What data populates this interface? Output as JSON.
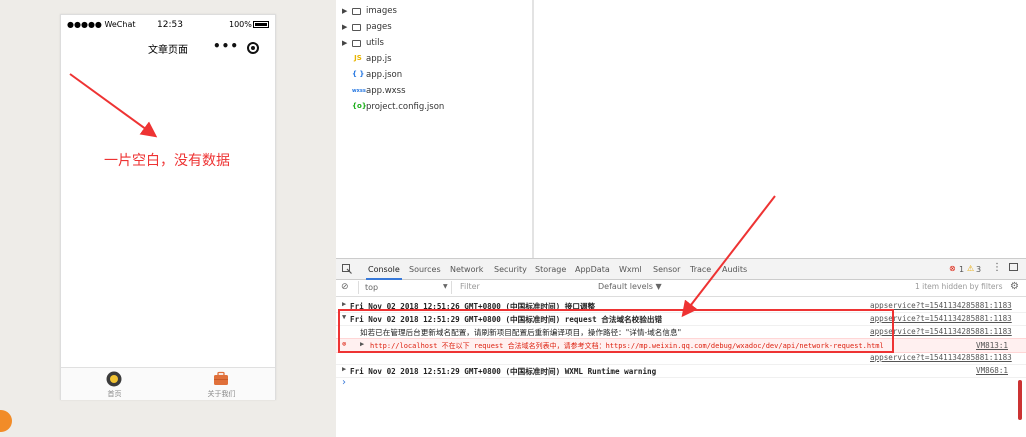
{
  "simulator": {
    "status": {
      "carrier": "●●●●● WeChat",
      "time": "12:53",
      "battery": "100%"
    },
    "nav_title": "文章页面",
    "more_icon": "more-dots-icon",
    "capsule_icon": "target-icon",
    "annotation": "一片空白，没有数据",
    "tabbar": [
      {
        "label": "首页",
        "icon": "home-icon",
        "color": "#3b3b3b"
      },
      {
        "label": "关于我们",
        "icon": "briefcase-icon",
        "color": "#e0703a"
      }
    ]
  },
  "files": [
    {
      "name": "images",
      "type": "folder"
    },
    {
      "name": "pages",
      "type": "folder"
    },
    {
      "name": "utils",
      "type": "folder"
    },
    {
      "name": "app.js",
      "type": "js",
      "icon": "JS",
      "color": "#e8b400"
    },
    {
      "name": "app.json",
      "type": "json",
      "icon": "{ }",
      "color": "#2a7ae2"
    },
    {
      "name": "app.wxss",
      "type": "wxss",
      "icon": "wxss",
      "color": "#2a7ae2"
    },
    {
      "name": "project.config.json",
      "type": "config",
      "icon": "{o}",
      "color": "#1aad19"
    }
  ],
  "devtools": {
    "tabs": [
      "Console",
      "Sources",
      "Network",
      "Security",
      "Storage",
      "AppData",
      "Wxml",
      "Sensor",
      "Trace",
      "Audits"
    ],
    "active_tab": "Console",
    "error_count": "1",
    "warning_count": "3",
    "context": "top",
    "filter_placeholder": "Filter",
    "levels": "Default levels ▼",
    "hidden_note": "1 item hidden by filters",
    "logs": [
      {
        "msg": "Fri Nov 02 2018 12:51:26 GMT+0800 (中国标准时间) 接口调整",
        "src": "appservice?t=1541134285881:1183",
        "kind": "group"
      },
      {
        "msg": "Fri Nov 02 2018 12:51:29 GMT+0800 (中国标准时间) request 合法域名校验出错",
        "src": "appservice?t=1541134285881:1183",
        "kind": "group-open"
      },
      {
        "msg": "如若已在管理后台更新域名配置，请刷新项目配置后重新编译项目，操作路径：\"详情-域名信息\"",
        "src": "appservice?t=1541134285881:1183",
        "kind": "child"
      },
      {
        "msg": "http://localhost 不在以下 request 合法域名列表中，请参考文档：https://mp.weixin.qq.com/debug/wxadoc/dev/api/network-request.html",
        "src": "VM813:1",
        "kind": "error"
      },
      {
        "msg": "",
        "src": "appservice?t=1541134285881:1183",
        "kind": "src-only"
      },
      {
        "msg": "Fri Nov 02 2018 12:51:29 GMT+0800 (中国标准时间) WXML Runtime warning",
        "src": "VM868:1",
        "kind": "group"
      }
    ],
    "prompt": "›"
  }
}
